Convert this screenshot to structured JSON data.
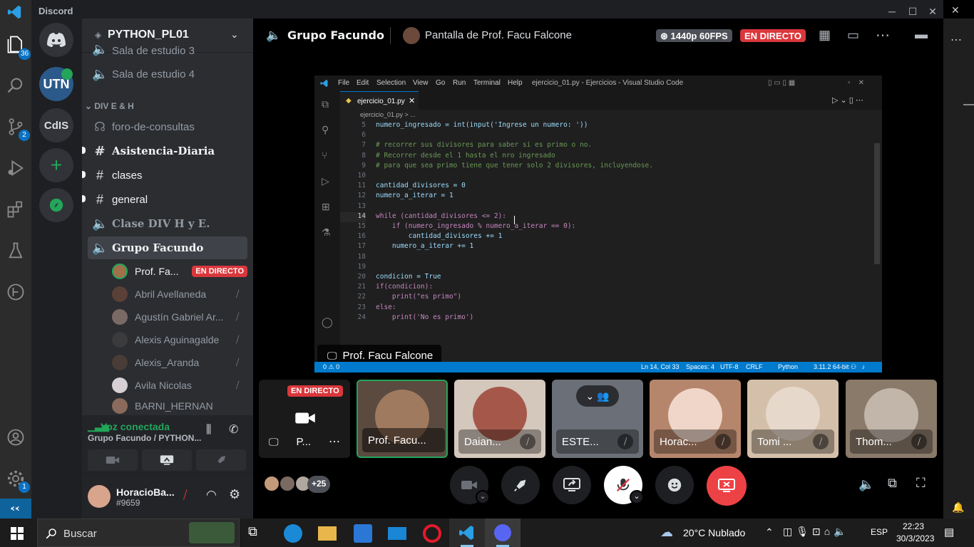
{
  "app": {
    "title": "Discord"
  },
  "vscode_activity": {
    "badges": {
      "explorer": "36",
      "source_control": "2",
      "settings": "1"
    }
  },
  "servers": [
    {
      "label": "UTN"
    },
    {
      "label": "CdIS"
    }
  ],
  "server_header": {
    "name": "PYTHON_PL01"
  },
  "channels": {
    "partial_top": "Sala de estudio 3",
    "sala4": "Sala de estudio 4",
    "category": "DIV E & H",
    "items": [
      {
        "name": "foro-de-consultas"
      },
      {
        "name": "Asistencia-Diaria"
      },
      {
        "name": "clases"
      },
      {
        "name": "general"
      },
      {
        "name": "Clase DIV H y E."
      },
      {
        "name": "Grupo Facundo"
      }
    ]
  },
  "voice_users": [
    {
      "name": "Prof. Fa...",
      "badge": "EN DIRECTO"
    },
    {
      "name": "Abril Avellaneda"
    },
    {
      "name": "Agustín Gabriel Ar..."
    },
    {
      "name": "Alexis Aguinagalde"
    },
    {
      "name": "Alexis_Aranda"
    },
    {
      "name": "Avila Nicolas"
    },
    {
      "name": "BARNI_HERNAN"
    }
  ],
  "voice_panel": {
    "status": "Voz conectada",
    "location": "Grupo Facundo / PYTHON..."
  },
  "user_panel": {
    "username": "HoracioBa...",
    "tag": "#9659"
  },
  "topbar": {
    "channel": "Grupo Facundo",
    "stream_title": "Pantalla de Prof. Facu Falcone",
    "quality": "1440p 60FPS",
    "live": "EN DIRECTO"
  },
  "inner_vscode": {
    "menu": [
      "File",
      "Edit",
      "Selection",
      "View",
      "Go",
      "Run",
      "Terminal",
      "Help"
    ],
    "window_title": "ejercicio_01.py - Ejercicios - Visual Studio Code",
    "tab": "ejercicio_01.py",
    "breadcrumb": "ejercicio_01.py > ...",
    "code": [
      {
        "no": "5",
        "text": "numero_ingresado = int(input('Ingrese un numero: '))"
      },
      {
        "no": "6",
        "text": ""
      },
      {
        "no": "7",
        "text": "# recorrer sus divisores para saber si es primo o no."
      },
      {
        "no": "8",
        "text": "# Recorrer desde el 1 hasta el nro ingresado"
      },
      {
        "no": "9",
        "text": "# para que sea primo tiene que tener solo 2 divisores, incluyendose."
      },
      {
        "no": "10",
        "text": ""
      },
      {
        "no": "11",
        "text": "cantidad_divisores = 0"
      },
      {
        "no": "12",
        "text": "numero_a_iterar = 1"
      },
      {
        "no": "13",
        "text": ""
      },
      {
        "no": "14",
        "text": "while (cantidad_divisores <= 2):"
      },
      {
        "no": "15",
        "text": "    if (numero_ingresado % numero_a_iterar == 0):"
      },
      {
        "no": "16",
        "text": "        cantidad_divisores += 1"
      },
      {
        "no": "17",
        "text": "    numero_a_iterar += 1"
      },
      {
        "no": "18",
        "text": ""
      },
      {
        "no": "19",
        "text": ""
      },
      {
        "no": "20",
        "text": "condicion = True"
      },
      {
        "no": "21",
        "text": "if(condicion):"
      },
      {
        "no": "22",
        "text": "    print(\"es primo\")"
      },
      {
        "no": "23",
        "text": "else:"
      },
      {
        "no": "24",
        "text": "    print('No es primo')"
      }
    ],
    "status": {
      "left": "0 ⚠ 0",
      "position": "Ln 14, Col 33",
      "spaces": "Spaces: 4",
      "encoding": "UTF-8",
      "eol": "CRLF",
      "language": "Python",
      "interpreter": "3.11.2 64-bit"
    }
  },
  "stream_overlay": {
    "name": "Prof. Facu Falcone"
  },
  "tiles": [
    {
      "name": "P...",
      "badge": "EN DIRECTO"
    },
    {
      "name": "Prof. Facu..."
    },
    {
      "name": "Daian..."
    },
    {
      "name": "ESTE..."
    },
    {
      "name": "Horac..."
    },
    {
      "name": "Tomi ..."
    },
    {
      "name": "Thom..."
    }
  ],
  "participants_extra": "+25",
  "colors": {
    "live_red": "#da373c",
    "voice_green": "#23a55a",
    "accent_blue": "#007acc",
    "end_call_red": "#ed4245"
  },
  "taskbar": {
    "search_placeholder": "Buscar",
    "weather": "20°C  Nublado",
    "lang": "ESP",
    "time": "22:23",
    "date": "30/3/2023"
  }
}
